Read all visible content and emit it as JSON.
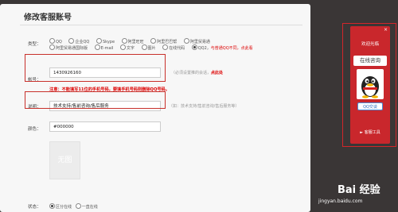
{
  "page": {
    "title": "修改客服账号"
  },
  "form": {
    "type_label": "类型：",
    "type_options": [
      "QQ",
      "企业QQ",
      "Skype",
      "阿里旺旺",
      "阿里巴巴帮",
      "阿里贸易通",
      "阿里贸易通国际版",
      "E-mail",
      "文字",
      "图片",
      "在线代码",
      "QQ2"
    ],
    "type_note": "与普通QQ不同，点此看",
    "account_label": "帐号：",
    "account_value": "1430926160",
    "account_hint": "（必须设置推的会话，",
    "account_hint_link": "点此处",
    "warning": "注意：不能填写11位的手机号码，要填手机号码则删除QQ号码。",
    "desc_label": "说明：",
    "desc_value": "技术支持/售前咨询/售后服务",
    "desc_hint": "（如：技术支持/售前咨询/售后服务等）",
    "color_label": "颜色：",
    "color_value": "#000000",
    "image_placeholder": "无图",
    "status_label": "状态：",
    "status_options": [
      "区分在线",
      "一直在线"
    ]
  },
  "widget": {
    "header": "欢迎光临",
    "close": "×",
    "online_label": "在线咨询",
    "qq_button": "QQ交谈",
    "footer": "► 客服工具"
  },
  "watermark": {
    "text": "Bai 经验",
    "sub": "jingyan.baidu.com"
  },
  "colors": {
    "highlight": "#c8302b",
    "widget_red": "#c9272c",
    "warning_red": "#dd0000"
  }
}
